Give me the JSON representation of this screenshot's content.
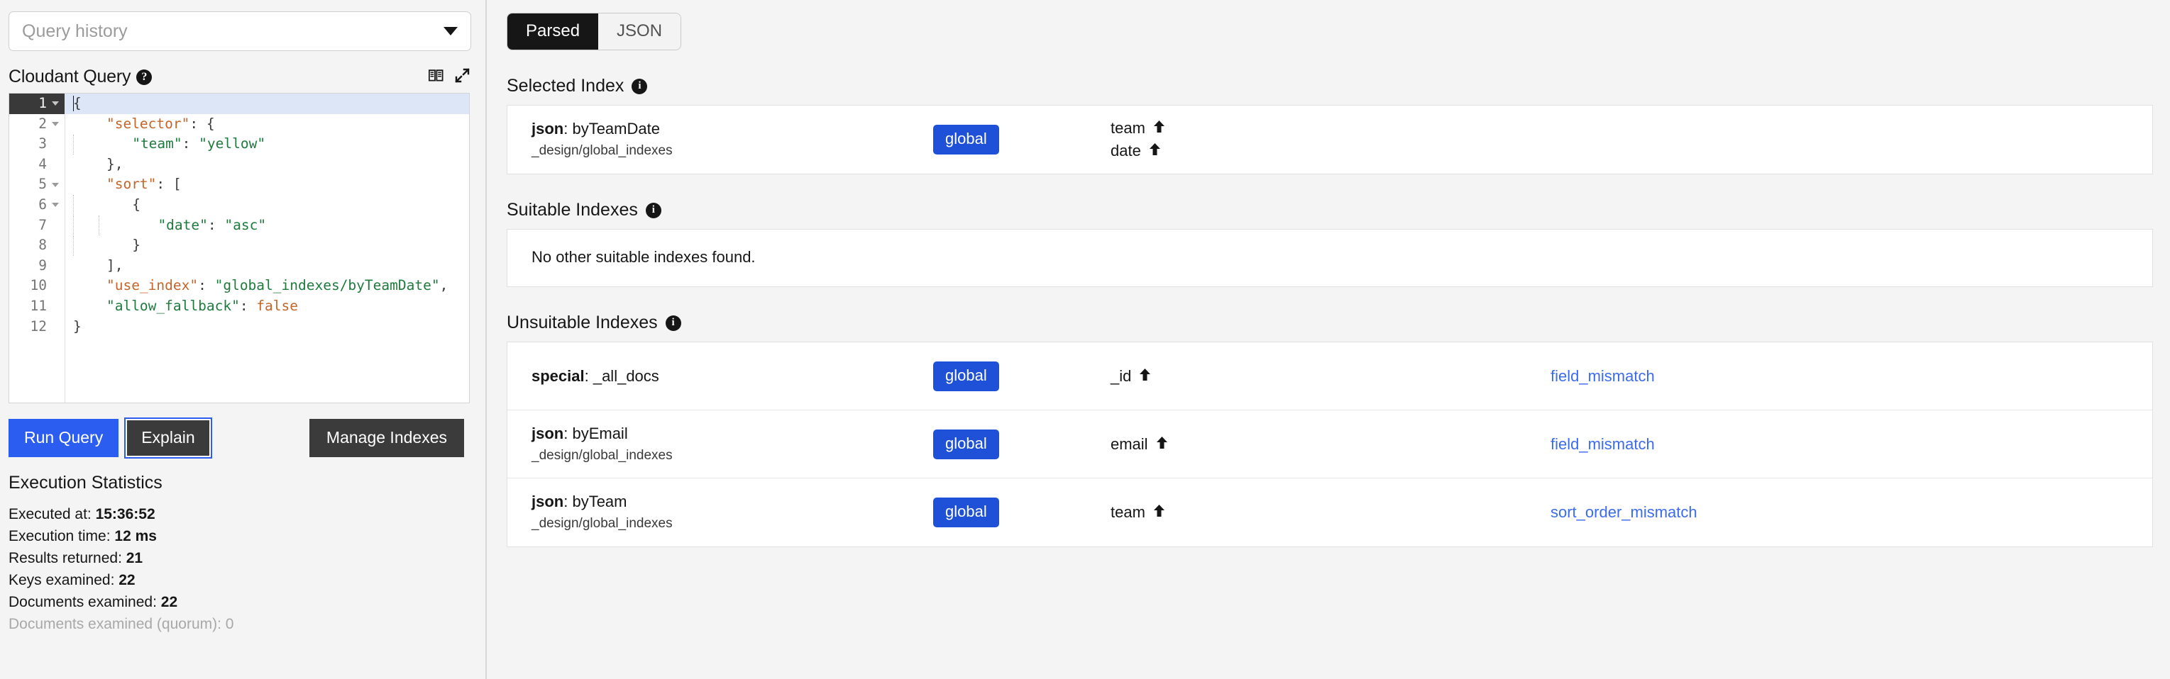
{
  "left": {
    "query_history": {
      "placeholder": "Query history"
    },
    "editor_title": "Cloudant Query",
    "help_glyph": "?",
    "code_lines": [
      {
        "num": "1",
        "fold": true,
        "active": true,
        "tokens": [
          {
            "t": "{",
            "c": "pun"
          }
        ]
      },
      {
        "num": "2",
        "fold": true,
        "active": false,
        "indent": 1,
        "tokens": [
          {
            "t": "\"selector\"",
            "c": "key"
          },
          {
            "t": ": {",
            "c": "pun"
          }
        ]
      },
      {
        "num": "3",
        "fold": false,
        "active": false,
        "indent": 2,
        "guides": 1,
        "tokens": [
          {
            "t": "\"team\"",
            "c": "str"
          },
          {
            "t": ": ",
            "c": "pun"
          },
          {
            "t": "\"yellow\"",
            "c": "str"
          }
        ]
      },
      {
        "num": "4",
        "fold": false,
        "active": false,
        "indent": 1,
        "tokens": [
          {
            "t": "},",
            "c": "pun"
          }
        ]
      },
      {
        "num": "5",
        "fold": true,
        "active": false,
        "indent": 1,
        "tokens": [
          {
            "t": "\"sort\"",
            "c": "key"
          },
          {
            "t": ": [",
            "c": "pun"
          }
        ]
      },
      {
        "num": "6",
        "fold": true,
        "active": false,
        "indent": 2,
        "guides": 1,
        "tokens": [
          {
            "t": "{",
            "c": "pun"
          }
        ]
      },
      {
        "num": "7",
        "fold": false,
        "active": false,
        "indent": 3,
        "guides": 2,
        "tokens": [
          {
            "t": "\"date\"",
            "c": "str"
          },
          {
            "t": ": ",
            "c": "pun"
          },
          {
            "t": "\"asc\"",
            "c": "str"
          }
        ]
      },
      {
        "num": "8",
        "fold": false,
        "active": false,
        "indent": 2,
        "guides": 1,
        "tokens": [
          {
            "t": "}",
            "c": "pun"
          }
        ]
      },
      {
        "num": "9",
        "fold": false,
        "active": false,
        "indent": 1,
        "tokens": [
          {
            "t": "],",
            "c": "pun"
          }
        ]
      },
      {
        "num": "10",
        "fold": false,
        "active": false,
        "indent": 1,
        "tokens": [
          {
            "t": "\"use_index\"",
            "c": "key"
          },
          {
            "t": ": ",
            "c": "pun"
          },
          {
            "t": "\"global_indexes/byTeamDate\"",
            "c": "str"
          },
          {
            "t": ",",
            "c": "pun"
          }
        ]
      },
      {
        "num": "11",
        "fold": false,
        "active": false,
        "indent": 1,
        "tokens": [
          {
            "t": "\"allow_fallback\"",
            "c": "str"
          },
          {
            "t": ": ",
            "c": "pun"
          },
          {
            "t": "false",
            "c": "key"
          }
        ]
      },
      {
        "num": "12",
        "fold": false,
        "active": false,
        "tokens": [
          {
            "t": "}",
            "c": "pun"
          }
        ]
      }
    ],
    "buttons": {
      "run_query": "Run Query",
      "explain": "Explain",
      "manage_indexes": "Manage Indexes"
    },
    "stats": {
      "title": "Execution Statistics",
      "items": [
        {
          "label": "Executed at: ",
          "value": "15:36:52",
          "muted": false
        },
        {
          "label": "Execution time: ",
          "value": "12 ms",
          "muted": false
        },
        {
          "label": "Results returned: ",
          "value": "21",
          "muted": false
        },
        {
          "label": "Keys examined: ",
          "value": "22",
          "muted": false
        },
        {
          "label": "Documents examined: ",
          "value": "22",
          "muted": false
        },
        {
          "label": "Documents examined (quorum): ",
          "value": "0",
          "muted": true
        }
      ]
    }
  },
  "right": {
    "tabs": [
      {
        "label": "Parsed",
        "active": true
      },
      {
        "label": "JSON",
        "active": false
      }
    ],
    "selected_index": {
      "title": "Selected Index",
      "rows": [
        {
          "type": "json",
          "name": "byTeamDate",
          "ddoc": "_design/global_indexes",
          "badge": "global",
          "fields": [
            {
              "name": "team",
              "direction": "asc"
            },
            {
              "name": "date",
              "direction": "asc"
            }
          ],
          "reason": ""
        }
      ]
    },
    "suitable_indexes": {
      "title": "Suitable Indexes",
      "empty_message": "No other suitable indexes found."
    },
    "unsuitable_indexes": {
      "title": "Unsuitable Indexes",
      "rows": [
        {
          "type": "special",
          "name": "_all_docs",
          "ddoc": "",
          "badge": "global",
          "fields": [
            {
              "name": "_id",
              "direction": "asc"
            }
          ],
          "reason": "field_mismatch"
        },
        {
          "type": "json",
          "name": "byEmail",
          "ddoc": "_design/global_indexes",
          "badge": "global",
          "fields": [
            {
              "name": "email",
              "direction": "asc"
            }
          ],
          "reason": "field_mismatch"
        },
        {
          "type": "json",
          "name": "byTeam",
          "ddoc": "_design/global_indexes",
          "badge": "global",
          "fields": [
            {
              "name": "team",
              "direction": "asc"
            }
          ],
          "reason": "sort_order_mismatch"
        }
      ]
    }
  },
  "colors": {
    "accent_blue": "#2b5df0",
    "badge_blue": "#1f51d8",
    "link_blue": "#3b6bf0",
    "dark": "#161616"
  }
}
